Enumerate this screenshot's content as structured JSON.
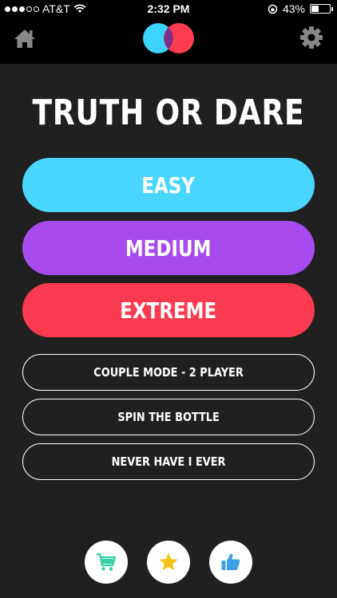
{
  "status_bar": {
    "carrier": "AT&T",
    "time": "2:32 PM",
    "battery": "43%",
    "battery_level": 0.43
  },
  "nav": {
    "home_icon": "home-icon",
    "logo": "two-overlapping-circles-logo",
    "settings_icon": "gear-icon"
  },
  "title": "TRUTH OR DARE",
  "levels": [
    {
      "label": "EASY",
      "color": "#48d6ff"
    },
    {
      "label": "MEDIUM",
      "color": "#a84bee"
    },
    {
      "label": "EXTREME",
      "color": "#fa3a4e"
    }
  ],
  "modes": [
    {
      "label": "COUPLE MODE - 2 PLAYER"
    },
    {
      "label": "SPIN THE BOTTLE"
    },
    {
      "label": "NEVER HAVE I EVER"
    }
  ],
  "footer_buttons": [
    {
      "icon": "cart-icon",
      "color": "#39d0a8"
    },
    {
      "icon": "star-icon",
      "color": "#f5c518"
    },
    {
      "icon": "thumbs-up-icon",
      "color": "#3aa0e8"
    }
  ]
}
